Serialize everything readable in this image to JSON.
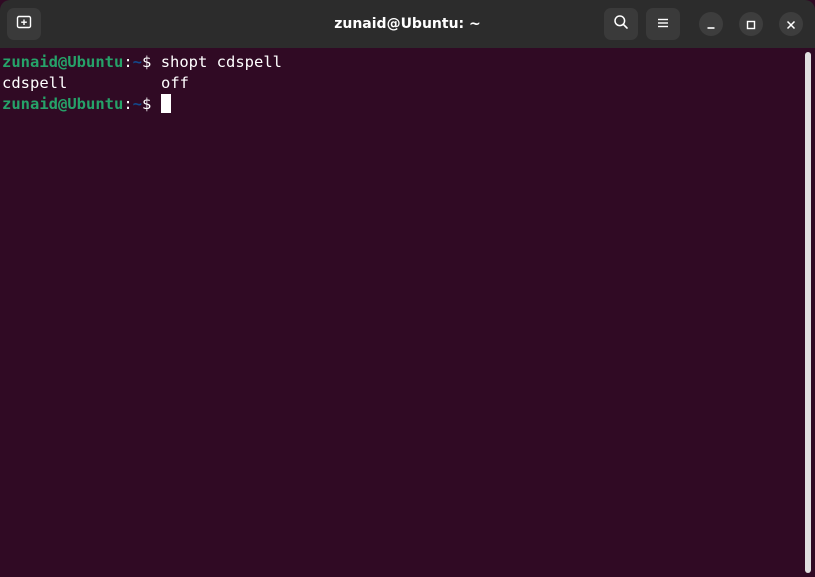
{
  "window": {
    "title": "zunaid@Ubuntu: ~"
  },
  "header": {
    "new_tab_icon": "new-tab-icon",
    "search_icon": "search-icon",
    "menu_icon": "hamburger-menu-icon",
    "minimize_icon": "minimize-icon",
    "maximize_icon": "maximize-icon",
    "close_icon": "close-icon"
  },
  "terminal": {
    "lines": [
      {
        "user": "zunaid@Ubuntu",
        "sep": ":",
        "path": "~",
        "prompt": "$ ",
        "command": "shopt cdspell"
      },
      {
        "output_name": "cdspell",
        "output_value": "off"
      },
      {
        "user": "zunaid@Ubuntu",
        "sep": ":",
        "path": "~",
        "prompt": "$ ",
        "command": ""
      }
    ]
  },
  "colors": {
    "background": "#300a24",
    "titlebar": "#2c2c2c",
    "prompt_user": "#26a269",
    "prompt_path": "#12488b",
    "text": "#ffffff"
  }
}
